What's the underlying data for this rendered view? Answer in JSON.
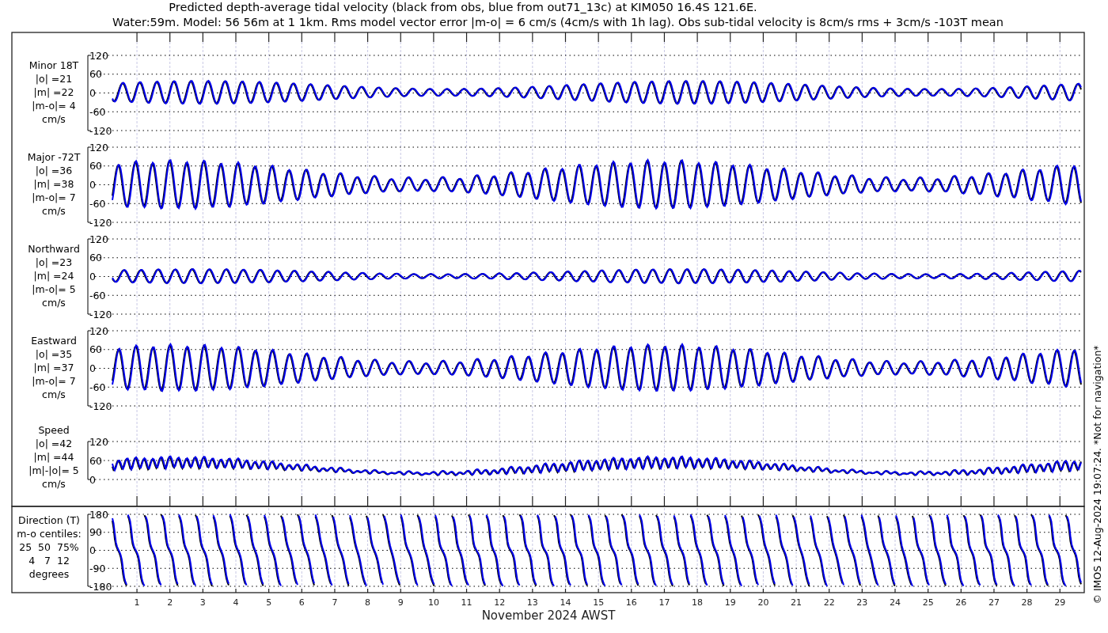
{
  "title": [
    "Predicted depth-average tidal velocity (black from obs, blue from out71_13c) at KIM050 16.4S 121.6E.",
    "Water:59m. Model: 56 56m at 1 1km. Rms model vector error |m-o| = 6 cm/s (4cm/s with 1h lag). Obs sub-tidal velocity is 8cm/s rms + 3cm/s -103T mean"
  ],
  "panels": [
    {
      "kind": "velocity",
      "labels": [
        "Minor 18T",
        "|o| =21",
        "|m| =22",
        "|m-o|= 4",
        "cm/s"
      ],
      "yticks": [
        "120",
        "60",
        "0",
        "-60",
        "-120"
      ]
    },
    {
      "kind": "velocity",
      "labels": [
        "Major -72T",
        "|o| =36",
        "|m| =38",
        "|m-o|= 7",
        "cm/s"
      ],
      "yticks": [
        "120",
        "60",
        "0",
        "-60",
        "-120"
      ]
    },
    {
      "kind": "velocity",
      "labels": [
        "Northward",
        "|o| =23",
        "|m| =24",
        "|m-o|= 5",
        "cm/s"
      ],
      "yticks": [
        "120",
        "60",
        "0",
        "-60",
        "-120"
      ]
    },
    {
      "kind": "velocity",
      "labels": [
        "Eastward",
        "|o| =35",
        "|m| =37",
        "|m-o|= 7",
        "cm/s"
      ],
      "yticks": [
        "120",
        "60",
        "0",
        "-60",
        "-120"
      ]
    },
    {
      "kind": "speed",
      "labels": [
        "Speed",
        "|o| =42",
        "|m| =44",
        "|m|-|o|= 5",
        "cm/s"
      ],
      "yticks": [
        "120",
        "60",
        "0"
      ]
    },
    {
      "kind": "direction",
      "labels": [
        "Direction (T)",
        "m-o centiles:",
        "25  50  75%",
        "4   7  12",
        "degrees"
      ],
      "yticks": [
        "180",
        "90",
        "0",
        "-90",
        "-180"
      ]
    }
  ],
  "xticks": [
    "1",
    "2",
    "3",
    "4",
    "5",
    "6",
    "7",
    "8",
    "9",
    "10",
    "11",
    "12",
    "13",
    "14",
    "15",
    "16",
    "17",
    "18",
    "19",
    "20",
    "21",
    "22",
    "23",
    "24",
    "25",
    "26",
    "27",
    "28",
    "29"
  ],
  "xlabel": "November 2024 AWST",
  "footer": "© IMOS 12-Aug-2024 19:07:24. *Not for navigation*"
}
